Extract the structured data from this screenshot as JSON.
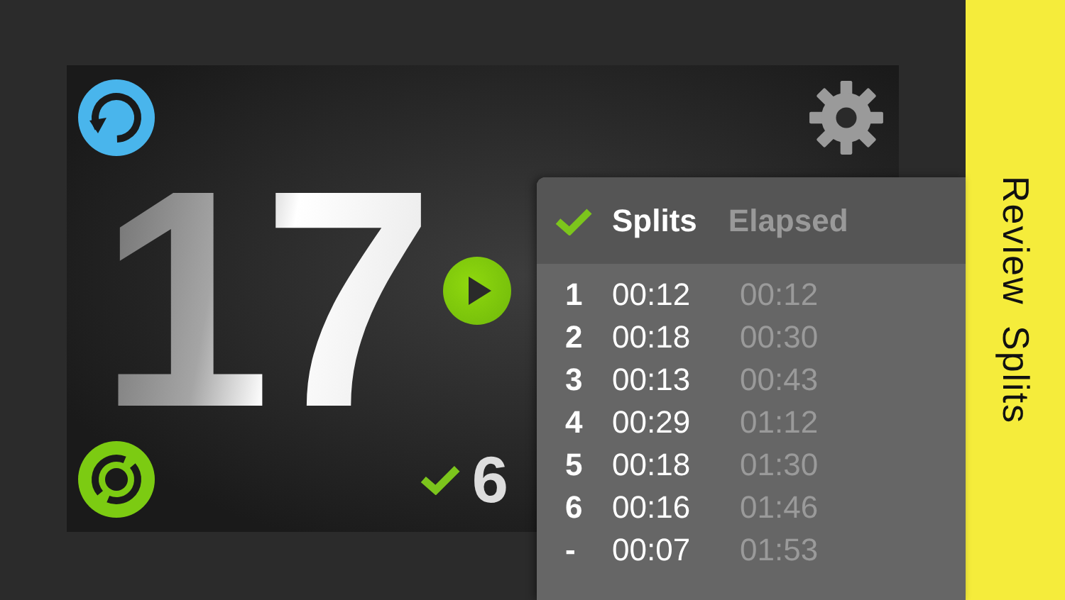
{
  "timer": {
    "count": "17",
    "completed": "6"
  },
  "splits": {
    "columns": [
      "Splits",
      "Elapsed"
    ],
    "rows": [
      {
        "index": "1",
        "split": "00:12",
        "elapsed": "00:12"
      },
      {
        "index": "2",
        "split": "00:18",
        "elapsed": "00:30"
      },
      {
        "index": "3",
        "split": "00:13",
        "elapsed": "00:43"
      },
      {
        "index": "4",
        "split": "00:29",
        "elapsed": "01:12"
      },
      {
        "index": "5",
        "split": "00:18",
        "elapsed": "01:30"
      },
      {
        "index": "6",
        "split": "00:16",
        "elapsed": "01:46"
      },
      {
        "index": "-",
        "split": "00:07",
        "elapsed": "01:53"
      }
    ]
  },
  "side_tab": {
    "label": "Review Splits"
  }
}
